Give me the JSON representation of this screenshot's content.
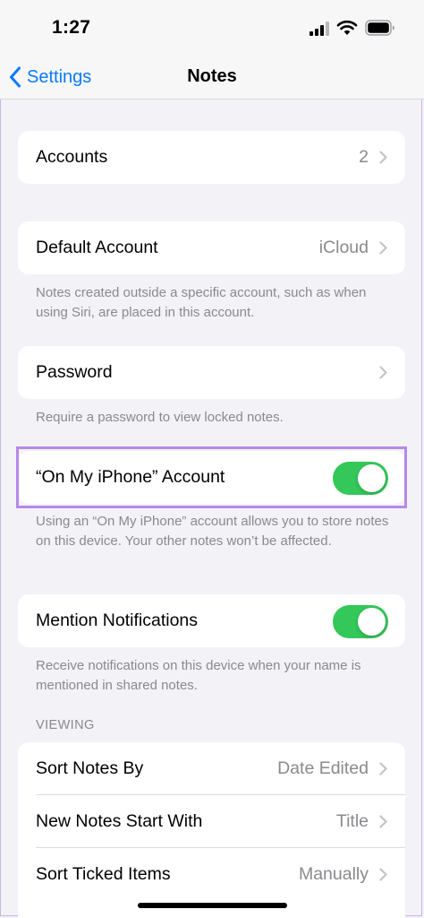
{
  "status_bar": {
    "time": "1:27"
  },
  "nav": {
    "back_label": "Settings",
    "title": "Notes"
  },
  "groups": {
    "accounts": {
      "label": "Accounts",
      "value": "2"
    },
    "default_account": {
      "label": "Default Account",
      "value": "iCloud",
      "footer": "Notes created outside a specific account, such as when using Siri, are placed in this account."
    },
    "password": {
      "label": "Password",
      "footer": "Require a password to view locked notes."
    },
    "on_my_iphone": {
      "label": "“On My iPhone” Account",
      "enabled": true,
      "footer": "Using an “On My iPhone” account allows you to store notes on this device. Your other notes won’t be affected."
    },
    "mention_notifications": {
      "label": "Mention Notifications",
      "enabled": true,
      "footer": "Receive notifications on this device when your name is mentioned in shared notes."
    }
  },
  "viewing": {
    "header": "VIEWING",
    "items": [
      {
        "label": "Sort Notes By",
        "value": "Date Edited"
      },
      {
        "label": "New Notes Start With",
        "value": "Title"
      },
      {
        "label": "Sort Ticked Items",
        "value": "Manually"
      }
    ]
  },
  "colors": {
    "accent": "#0a7aff",
    "toggle_on": "#34c759",
    "highlight": "#b58ae8"
  }
}
